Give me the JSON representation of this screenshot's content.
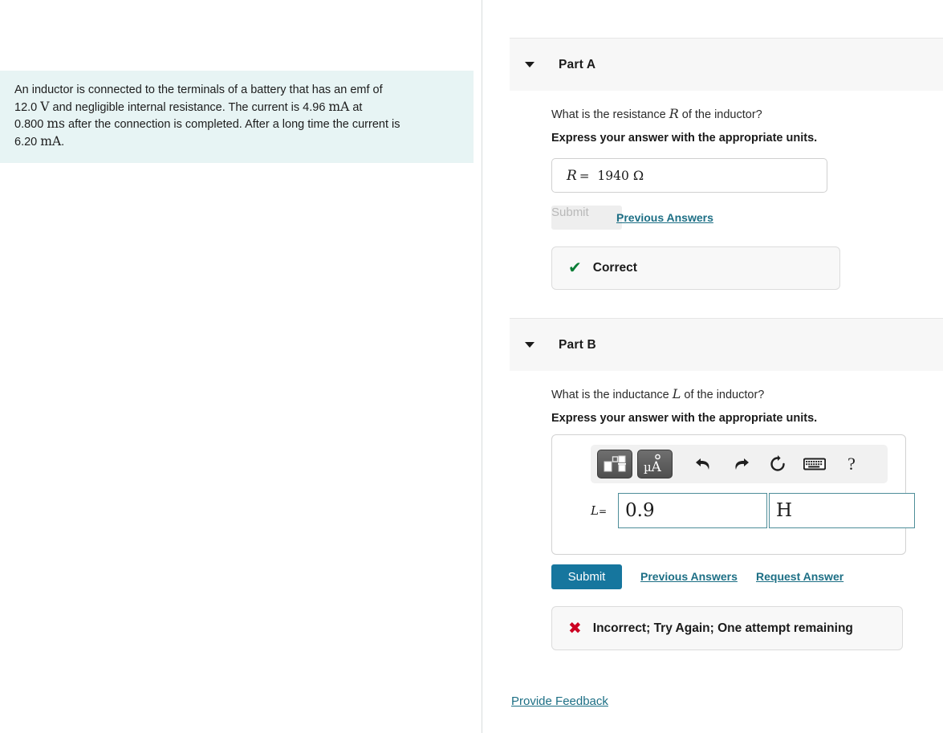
{
  "problem": {
    "text_segments": [
      {
        "t": "An inductor is connected to the terminals of a battery that has an emf of ",
        "k": "plain"
      },
      {
        "t": "12.0",
        "k": "plain"
      },
      {
        "t": "V",
        "k": "rm"
      },
      {
        "t": " and negligible internal resistance. The current is 4.96 ",
        "k": "plain"
      },
      {
        "t": "mA",
        "k": "rm"
      },
      {
        "t": " at 0.800 ",
        "k": "plain"
      },
      {
        "t": "ms",
        "k": "rm"
      },
      {
        "t": " after the connection is completed. After a long time the current is 6.20 ",
        "k": "plain"
      },
      {
        "t": "mA",
        "k": "rm"
      },
      {
        "t": ".",
        "k": "plain"
      }
    ],
    "line1": "An inductor is connected to the terminals of a battery that has an emf of",
    "line2_pre": "12.0",
    "line2_unit": "V",
    "line2_mid": "and negligible internal resistance. The current is 4.96",
    "line2_unit2": "mA",
    "line2_end": "at",
    "line3_pre": "0.800",
    "line3_unit": "ms",
    "line3_mid": "after the connection is completed. After a long time the current is",
    "line4_pre": "6.20",
    "line4_unit": "mA",
    "line4_end": "."
  },
  "part_a": {
    "title": "Part A",
    "caret_icon": "caret-down-icon",
    "question_pre": "What is the resistance",
    "question_var": "R",
    "question_post": "of the inductor?",
    "instruction": "Express your answer with the appropriate units.",
    "answer": {
      "label": "R",
      "equals": "=",
      "value": "1940",
      "unit": "Ω"
    },
    "submit_label": "Submit",
    "previous_answers_label": "Previous Answers",
    "feedback": {
      "icon": "check-icon",
      "glyph": "✔",
      "text": "Correct",
      "color": "#0a7d36"
    }
  },
  "part_b": {
    "title": "Part B",
    "caret_icon": "caret-down-icon",
    "question_pre": "What is the inductance",
    "question_var": "L",
    "question_post": "of the inductor?",
    "instruction": "Express your answer with the appropriate units.",
    "toolbar": {
      "buttons": [
        {
          "name": "template-picker-button",
          "label": "",
          "type": "dark"
        },
        {
          "name": "units-picker-button",
          "label": "μÅ",
          "type": "dark"
        },
        {
          "name": "undo-button",
          "label": "undo-arrow-icon",
          "type": "plain"
        },
        {
          "name": "redo-button",
          "label": "redo-arrow-icon",
          "type": "plain"
        },
        {
          "name": "reset-button",
          "label": "reset-circular-arrow-icon",
          "type": "plain"
        },
        {
          "name": "keyboard-button",
          "label": "keyboard-icon",
          "type": "plain"
        },
        {
          "name": "help-button",
          "label": "?",
          "type": "plain"
        }
      ],
      "help_glyph": "?"
    },
    "input": {
      "label": "L",
      "equals": "=",
      "value": "0.9",
      "unit_value": "H",
      "value_placeholder": "",
      "unit_placeholder": ""
    },
    "submit_label": "Submit",
    "previous_answers_label": "Previous Answers",
    "request_answer_label": "Request Answer",
    "feedback": {
      "icon": "cross-icon",
      "glyph": "✖",
      "text": "Incorrect; Try Again; One attempt remaining",
      "color": "#cc0022"
    }
  },
  "footer": {
    "provide_feedback_label": "Provide Feedback"
  },
  "colors": {
    "problem_bg": "#e7f4f4",
    "header_band": "#f7f7f7",
    "link": "#1d6f85",
    "submit_active": "#16769e",
    "submit_disabled_bg": "#eeeeee",
    "correct": "#0a7d36",
    "incorrect": "#cc0022",
    "field_border": "#4e8e99"
  }
}
